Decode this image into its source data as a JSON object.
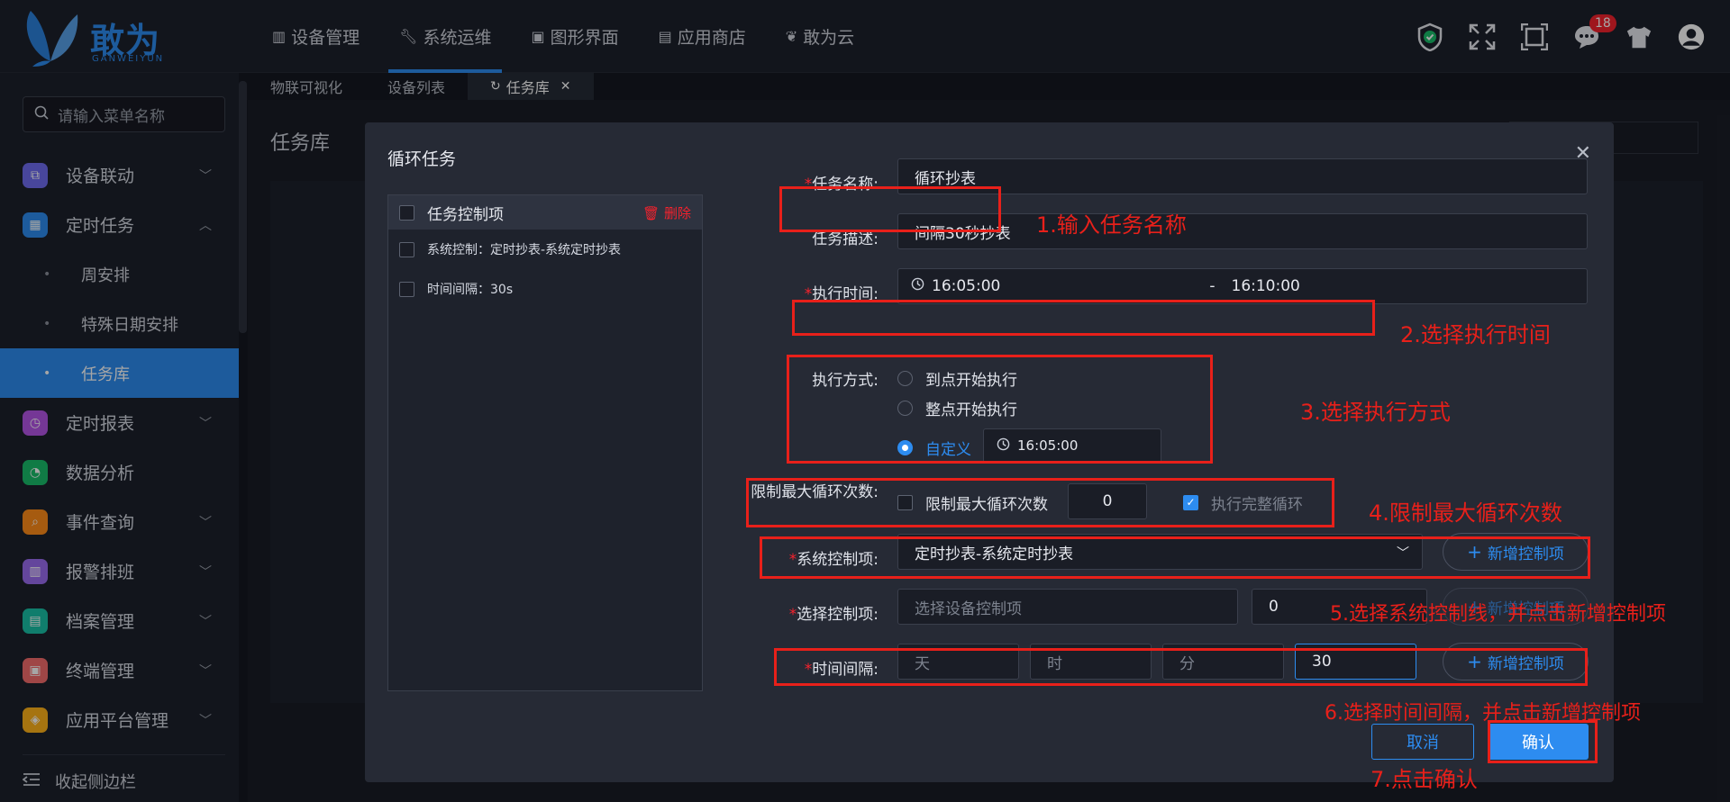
{
  "logo": {
    "name": "敢为云",
    "sub": "GANWEIYUN"
  },
  "nav": [
    {
      "label": "设备管理",
      "icon": "table-icon"
    },
    {
      "label": "系统运维",
      "icon": "wrench-icon"
    },
    {
      "label": "图形界面",
      "icon": "monitor-icon"
    },
    {
      "label": "应用商店",
      "icon": "store-icon"
    },
    {
      "label": "敢为云",
      "icon": "butterfly-icon"
    }
  ],
  "header": {
    "badge_count": "18"
  },
  "sidebar": {
    "search_placeholder": "请输入菜单名称",
    "items": [
      {
        "label": "设备联动",
        "color": "#6f6cf0"
      },
      {
        "label": "定时任务",
        "color": "#2d8cf0"
      },
      {
        "label": "定时报表",
        "color": "#b455e6"
      },
      {
        "label": "数据分析",
        "color": "#19be6b"
      },
      {
        "label": "事件查询",
        "color": "#ff8c1a"
      },
      {
        "label": "报警排班",
        "color": "#9a6cf0"
      },
      {
        "label": "档案管理",
        "color": "#19c0a6"
      },
      {
        "label": "终端管理",
        "color": "#f56c6c"
      },
      {
        "label": "应用平台管理",
        "color": "#ffb21a"
      }
    ],
    "subitems": [
      "周安排",
      "特殊日期安排",
      "任务库"
    ],
    "collapse": "收起侧边栏"
  },
  "tabs": [
    "物联可视化",
    "设备列表",
    "任务库"
  ],
  "page": {
    "title": "任务库"
  },
  "modal": {
    "title": "循环任务",
    "left_panel": {
      "header": "任务控制项",
      "delete": "删除",
      "rows": [
        "系统控制：定时抄表-系统定时抄表",
        "时间间隔：30s"
      ]
    },
    "form": {
      "name_label": "任务名称:",
      "name_value": "循环抄表",
      "desc_label": "任务描述:",
      "desc_value": "间隔30秒抄表",
      "time_label": "执行时间:",
      "time_start": "16:05:00",
      "time_sep": "-",
      "time_end": "16:10:00",
      "mode_label": "执行方式:",
      "mode_options": [
        "到点开始执行",
        "整点开始执行",
        "自定义"
      ],
      "mode_custom_time": "16:05:00",
      "limit_label": "限制最大循环次数:",
      "limit_check": "限制最大循环次数",
      "limit_value": "0",
      "full_cycle": "执行完整循环",
      "sys_label": "系统控制项:",
      "sys_value": "定时抄表-系统定时抄表",
      "add_btn": "新增控制项",
      "sel_label": "选择控制项:",
      "sel_placeholder": "选择设备控制项",
      "sel_value": "0",
      "sel_add_btn": "新增控制项",
      "interval_label": "时间间隔:",
      "interval_day": "天",
      "interval_hour": "时",
      "interval_min": "分",
      "interval_sec": "30"
    },
    "cancel": "取消",
    "ok": "确认"
  },
  "notes": [
    "1.输入任务名称",
    "2.选择执行时间",
    "3.选择执行方式",
    "4.限制最大循环次数",
    "5.选择系统控制线，并点击新增控制项",
    "6.选择时间间隔，并点击新增控制项",
    "7.点击确认"
  ]
}
